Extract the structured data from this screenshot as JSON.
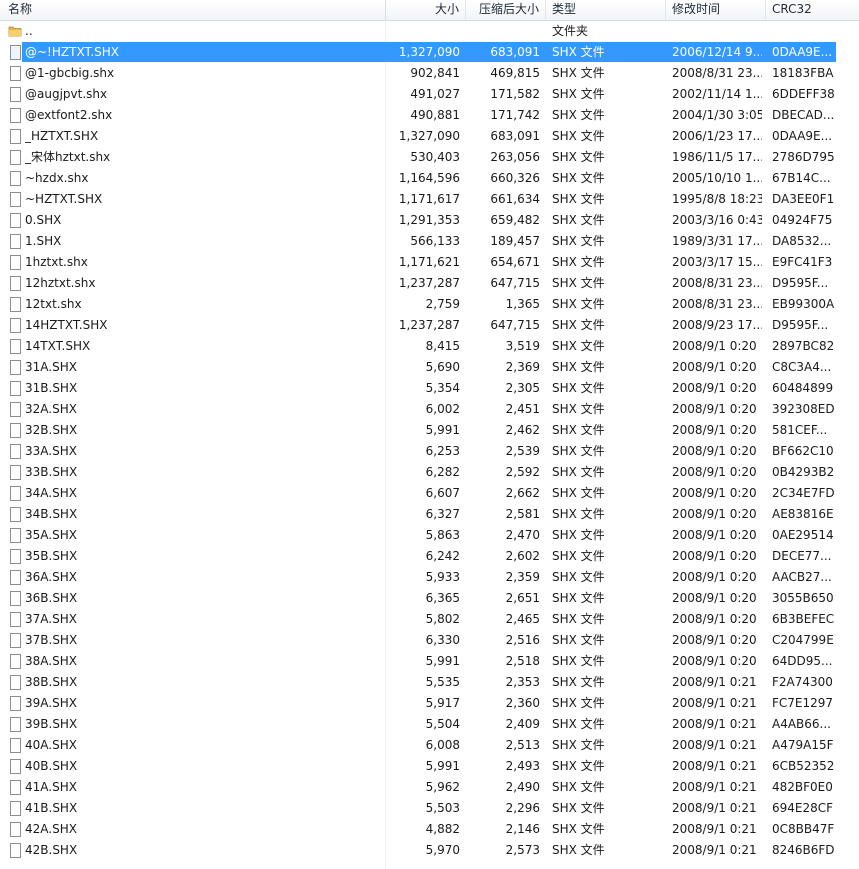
{
  "columns": {
    "name": "名称",
    "size": "大小",
    "packed": "压缩后大小",
    "type": "类型",
    "modified": "修改时间",
    "crc": "CRC32"
  },
  "rows": [
    {
      "icon": "folder-icon",
      "name": "..",
      "size": "",
      "packed": "",
      "type": "文件夹",
      "modified": "",
      "crc": ""
    },
    {
      "icon": "file-icon",
      "name": "@~!HZTXT.SHX",
      "size": "1,327,090",
      "packed": "683,091",
      "type": "SHX 文件",
      "modified": "2006/12/14 9...",
      "crc": "0DAA9E...",
      "selected": true
    },
    {
      "icon": "file-icon",
      "name": "@1-gbcbig.shx",
      "size": "902,841",
      "packed": "469,815",
      "type": "SHX 文件",
      "modified": "2008/8/31 23...",
      "crc": "18183FBA"
    },
    {
      "icon": "file-icon",
      "name": "@augjpvt.shx",
      "size": "491,027",
      "packed": "171,582",
      "type": "SHX 文件",
      "modified": "2002/11/14 1...",
      "crc": "6DDEFF38"
    },
    {
      "icon": "file-icon",
      "name": "@extfont2.shx",
      "size": "490,881",
      "packed": "171,742",
      "type": "SHX 文件",
      "modified": "2004/1/30 3:05",
      "crc": "DBECAD..."
    },
    {
      "icon": "file-icon",
      "name": "_HZTXT.SHX",
      "size": "1,327,090",
      "packed": "683,091",
      "type": "SHX 文件",
      "modified": "2006/1/23 17...",
      "crc": "0DAA9E..."
    },
    {
      "icon": "file-icon",
      "name": "_宋体hztxt.shx",
      "size": "530,403",
      "packed": "263,056",
      "type": "SHX 文件",
      "modified": "1986/11/5 17...",
      "crc": "2786D795"
    },
    {
      "icon": "file-icon",
      "name": "~hzdx.shx",
      "size": "1,164,596",
      "packed": "660,326",
      "type": "SHX 文件",
      "modified": "2005/10/10 1...",
      "crc": "67B14C..."
    },
    {
      "icon": "file-icon",
      "name": "~HZTXT.SHX",
      "size": "1,171,617",
      "packed": "661,634",
      "type": "SHX 文件",
      "modified": "1995/8/8 18:23",
      "crc": "DA3EE0F1"
    },
    {
      "icon": "file-icon",
      "name": "0.SHX",
      "size": "1,291,353",
      "packed": "659,482",
      "type": "SHX 文件",
      "modified": "2003/3/16 0:43",
      "crc": "04924F75"
    },
    {
      "icon": "file-icon",
      "name": "1.SHX",
      "size": "566,133",
      "packed": "189,457",
      "type": "SHX 文件",
      "modified": "1989/3/31 17...",
      "crc": "DA8532..."
    },
    {
      "icon": "file-icon",
      "name": "1hztxt.shx",
      "size": "1,171,621",
      "packed": "654,671",
      "type": "SHX 文件",
      "modified": "2003/3/17 15...",
      "crc": "E9FC41F3"
    },
    {
      "icon": "file-icon",
      "name": "12hztxt.shx",
      "size": "1,237,287",
      "packed": "647,715",
      "type": "SHX 文件",
      "modified": "2008/8/31 23...",
      "crc": "D9595F..."
    },
    {
      "icon": "file-icon",
      "name": "12txt.shx",
      "size": "2,759",
      "packed": "1,365",
      "type": "SHX 文件",
      "modified": "2008/8/31 23...",
      "crc": "EB99300A"
    },
    {
      "icon": "file-icon",
      "name": "14HZTXT.SHX",
      "size": "1,237,287",
      "packed": "647,715",
      "type": "SHX 文件",
      "modified": "2008/9/23 17...",
      "crc": "D9595F..."
    },
    {
      "icon": "file-icon",
      "name": "14TXT.SHX",
      "size": "8,415",
      "packed": "3,519",
      "type": "SHX 文件",
      "modified": "2008/9/1 0:20",
      "crc": "2897BC82"
    },
    {
      "icon": "file-icon",
      "name": "31A.SHX",
      "size": "5,690",
      "packed": "2,369",
      "type": "SHX 文件",
      "modified": "2008/9/1 0:20",
      "crc": "C8C3A4..."
    },
    {
      "icon": "file-icon",
      "name": "31B.SHX",
      "size": "5,354",
      "packed": "2,305",
      "type": "SHX 文件",
      "modified": "2008/9/1 0:20",
      "crc": "60484899"
    },
    {
      "icon": "file-icon",
      "name": "32A.SHX",
      "size": "6,002",
      "packed": "2,451",
      "type": "SHX 文件",
      "modified": "2008/9/1 0:20",
      "crc": "392308ED"
    },
    {
      "icon": "file-icon",
      "name": "32B.SHX",
      "size": "5,991",
      "packed": "2,462",
      "type": "SHX 文件",
      "modified": "2008/9/1 0:20",
      "crc": "581CEF..."
    },
    {
      "icon": "file-icon",
      "name": "33A.SHX",
      "size": "6,253",
      "packed": "2,539",
      "type": "SHX 文件",
      "modified": "2008/9/1 0:20",
      "crc": "BF662C10"
    },
    {
      "icon": "file-icon",
      "name": "33B.SHX",
      "size": "6,282",
      "packed": "2,592",
      "type": "SHX 文件",
      "modified": "2008/9/1 0:20",
      "crc": "0B4293B2"
    },
    {
      "icon": "file-icon",
      "name": "34A.SHX",
      "size": "6,607",
      "packed": "2,662",
      "type": "SHX 文件",
      "modified": "2008/9/1 0:20",
      "crc": "2C34E7FD"
    },
    {
      "icon": "file-icon",
      "name": "34B.SHX",
      "size": "6,327",
      "packed": "2,581",
      "type": "SHX 文件",
      "modified": "2008/9/1 0:20",
      "crc": "AE83816E"
    },
    {
      "icon": "file-icon",
      "name": "35A.SHX",
      "size": "5,863",
      "packed": "2,470",
      "type": "SHX 文件",
      "modified": "2008/9/1 0:20",
      "crc": "0AE29514"
    },
    {
      "icon": "file-icon",
      "name": "35B.SHX",
      "size": "6,242",
      "packed": "2,602",
      "type": "SHX 文件",
      "modified": "2008/9/1 0:20",
      "crc": "DECE77..."
    },
    {
      "icon": "file-icon",
      "name": "36A.SHX",
      "size": "5,933",
      "packed": "2,359",
      "type": "SHX 文件",
      "modified": "2008/9/1 0:20",
      "crc": "AACB27..."
    },
    {
      "icon": "file-icon",
      "name": "36B.SHX",
      "size": "6,365",
      "packed": "2,651",
      "type": "SHX 文件",
      "modified": "2008/9/1 0:20",
      "crc": "3055B650"
    },
    {
      "icon": "file-icon",
      "name": "37A.SHX",
      "size": "5,802",
      "packed": "2,465",
      "type": "SHX 文件",
      "modified": "2008/9/1 0:20",
      "crc": "6B3BEFEC"
    },
    {
      "icon": "file-icon",
      "name": "37B.SHX",
      "size": "6,330",
      "packed": "2,516",
      "type": "SHX 文件",
      "modified": "2008/9/1 0:20",
      "crc": "C204799E"
    },
    {
      "icon": "file-icon",
      "name": "38A.SHX",
      "size": "5,991",
      "packed": "2,518",
      "type": "SHX 文件",
      "modified": "2008/9/1 0:20",
      "crc": "64DD95..."
    },
    {
      "icon": "file-icon",
      "name": "38B.SHX",
      "size": "5,535",
      "packed": "2,353",
      "type": "SHX 文件",
      "modified": "2008/9/1 0:21",
      "crc": "F2A74300"
    },
    {
      "icon": "file-icon",
      "name": "39A.SHX",
      "size": "5,917",
      "packed": "2,360",
      "type": "SHX 文件",
      "modified": "2008/9/1 0:21",
      "crc": "FC7E1297"
    },
    {
      "icon": "file-icon",
      "name": "39B.SHX",
      "size": "5,504",
      "packed": "2,409",
      "type": "SHX 文件",
      "modified": "2008/9/1 0:21",
      "crc": "A4AB66..."
    },
    {
      "icon": "file-icon",
      "name": "40A.SHX",
      "size": "6,008",
      "packed": "2,513",
      "type": "SHX 文件",
      "modified": "2008/9/1 0:21",
      "crc": "A479A15F"
    },
    {
      "icon": "file-icon",
      "name": "40B.SHX",
      "size": "5,991",
      "packed": "2,493",
      "type": "SHX 文件",
      "modified": "2008/9/1 0:21",
      "crc": "6CB52352"
    },
    {
      "icon": "file-icon",
      "name": "41A.SHX",
      "size": "5,962",
      "packed": "2,490",
      "type": "SHX 文件",
      "modified": "2008/9/1 0:21",
      "crc": "482BF0E0"
    },
    {
      "icon": "file-icon",
      "name": "41B.SHX",
      "size": "5,503",
      "packed": "2,296",
      "type": "SHX 文件",
      "modified": "2008/9/1 0:21",
      "crc": "694E28CF"
    },
    {
      "icon": "file-icon",
      "name": "42A.SHX",
      "size": "4,882",
      "packed": "2,146",
      "type": "SHX 文件",
      "modified": "2008/9/1 0:21",
      "crc": "0C8BB47F"
    },
    {
      "icon": "file-icon",
      "name": "42B.SHX",
      "size": "5,970",
      "packed": "2,573",
      "type": "SHX 文件",
      "modified": "2008/9/1 0:21",
      "crc": "8246B6FD"
    }
  ],
  "colors": {
    "selection": "#3399ff",
    "folder": "#e8b64a"
  }
}
